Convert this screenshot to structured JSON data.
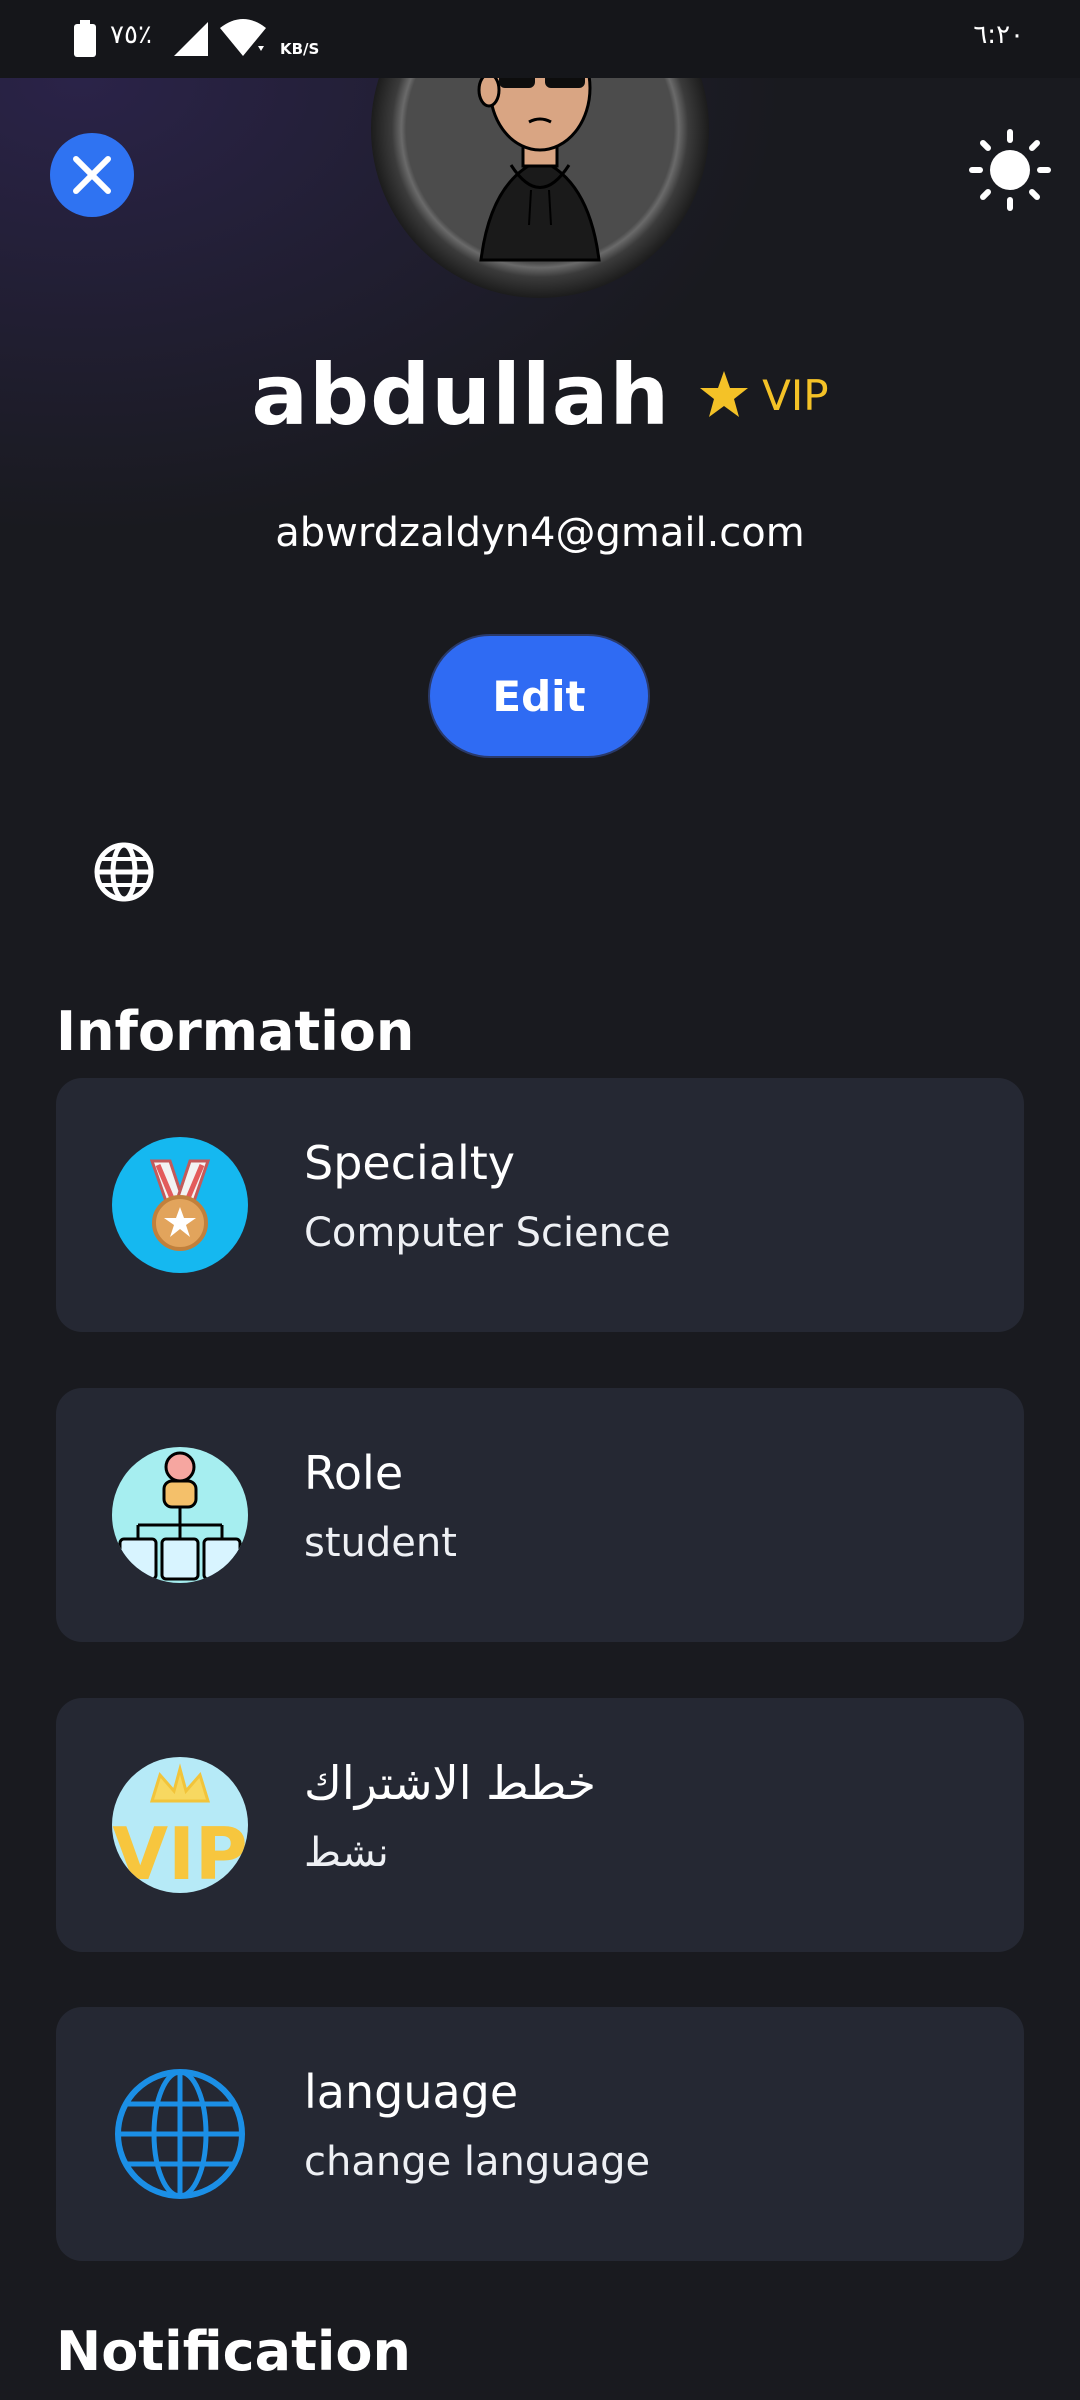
{
  "status_bar": {
    "battery": "٧٥٪",
    "speed_unit": "KB/S",
    "time": "٦:٢٠"
  },
  "header": {
    "close_icon": "close-icon",
    "theme_icon": "sun-icon"
  },
  "profile": {
    "name": "abdullah",
    "badge": "VIP",
    "email": "abwrdzaldyn4@gmail.com",
    "edit_label": "Edit"
  },
  "sections": {
    "information": "Information",
    "notification": "Notification"
  },
  "cards": [
    {
      "title": "Specialty",
      "subtitle": "Computer Science",
      "icon": "medal-icon"
    },
    {
      "title": "Role",
      "subtitle": "student",
      "icon": "org-chart-icon"
    },
    {
      "title": "خطط الاشتراك",
      "subtitle": "نشط",
      "icon": "vip-crown-icon"
    },
    {
      "title": "language",
      "subtitle": "change language",
      "icon": "globe-icon"
    }
  ],
  "colors": {
    "background": "#191a1f",
    "card": "#252833",
    "accent": "#2f73f2",
    "vip": "#f4c227"
  }
}
